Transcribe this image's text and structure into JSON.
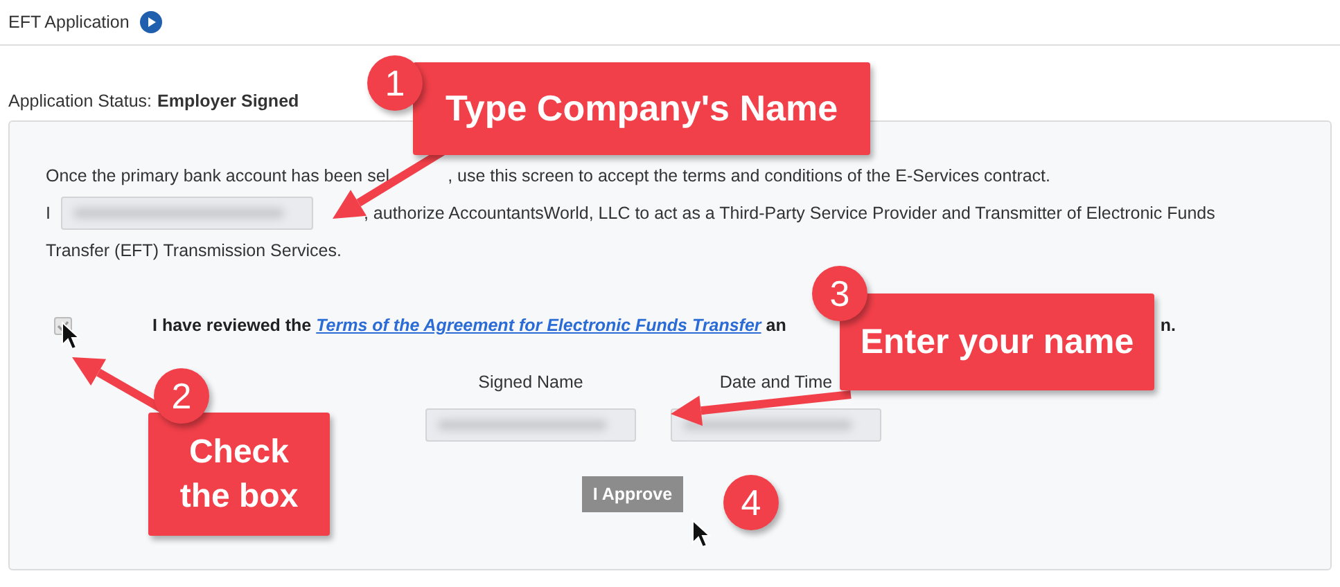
{
  "header": {
    "title": "EFT Application"
  },
  "status": {
    "label": "Application Status:",
    "value": "Employer Signed"
  },
  "intro": {
    "start": "Once the primary bank account has been sel",
    "end": ", use this screen to accept the terms and conditions of the E-Services contract."
  },
  "authorize": {
    "prefix": "I",
    "lines": [
      ", authorize AccountantsWorld, LLC to act as a Third-Party Service Provider and Transmitter of Electronic Funds",
      "Transfer (EFT) Transmission Services."
    ]
  },
  "agreement": {
    "checked": true,
    "disabled": true,
    "text_before": "I have reviewed the",
    "link": "Terms of the Agreement for Electronic Funds Transfer",
    "text_after": "an",
    "text_end": "n."
  },
  "signature": {
    "fields": [
      {
        "label": "Signed Name"
      },
      {
        "label": "Date and Time"
      }
    ]
  },
  "approve_button": "I Approve",
  "callouts": [
    {
      "number": "1",
      "text": "Type Company's Name"
    },
    {
      "number": "2",
      "text": "Check the box"
    },
    {
      "number": "3",
      "text": "Enter your name"
    },
    {
      "number": "4"
    }
  ]
}
